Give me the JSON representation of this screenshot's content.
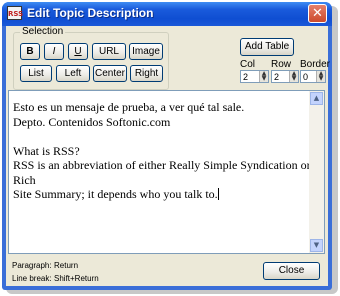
{
  "window": {
    "title": "Edit Topic Description",
    "app_icon": "RSS",
    "close_glyph": "✕"
  },
  "selection": {
    "label": "Selection",
    "bold": "B",
    "italic": "I",
    "underline": "U",
    "url": "URL",
    "image": "Image",
    "list": "List",
    "left": "Left",
    "center": "Center",
    "right": "Right"
  },
  "table": {
    "add_label": "Add Table",
    "col_label": "Col",
    "row_label": "Row",
    "border_label": "Border",
    "col_value": "2",
    "row_value": "2",
    "border_value": "0"
  },
  "editor": {
    "lines": [
      "Esto es un mensaje de prueba, a ver qué tal sale.",
      "Depto. Contenidos Softonic.com",
      "",
      "What is RSS?",
      "RSS is an abbreviation of either Really Simple Syndication or Rich",
      "Site Summary; it depends who you talk to."
    ]
  },
  "footer": {
    "paragraph_label": "Paragraph:",
    "paragraph_key": "Return",
    "linebreak_label": "Line break:",
    "linebreak_key": "Shift+Return",
    "close_label": "Close"
  }
}
